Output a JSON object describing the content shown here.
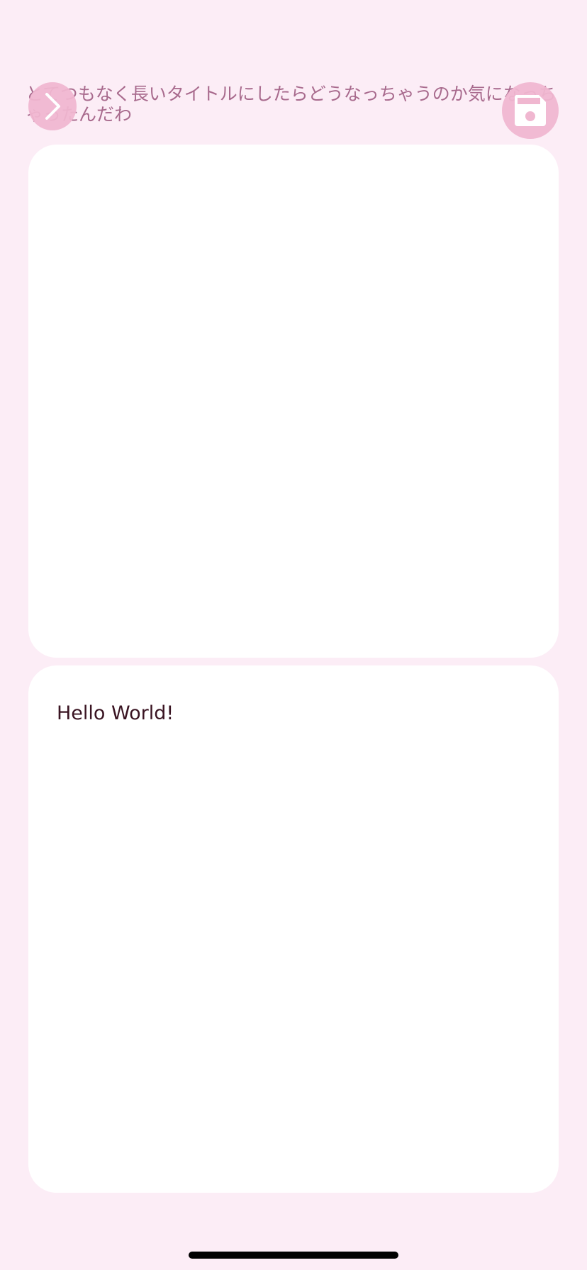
{
  "header": {
    "title": "とてつもなく長いタイトルにしたらどうなっちゃうのか気になっちゃったんだわ",
    "forward_icon": "chevron-right-icon",
    "save_icon": "floppy-disk-icon"
  },
  "cards": {
    "top": {},
    "bottom": {
      "text": "Hello World!"
    }
  },
  "colors": {
    "background": "#FCEDF6",
    "accent": "#F0B7D0",
    "title_text": "#A86A8D",
    "body_text": "#3A1422",
    "card": "#FFFFFF"
  }
}
